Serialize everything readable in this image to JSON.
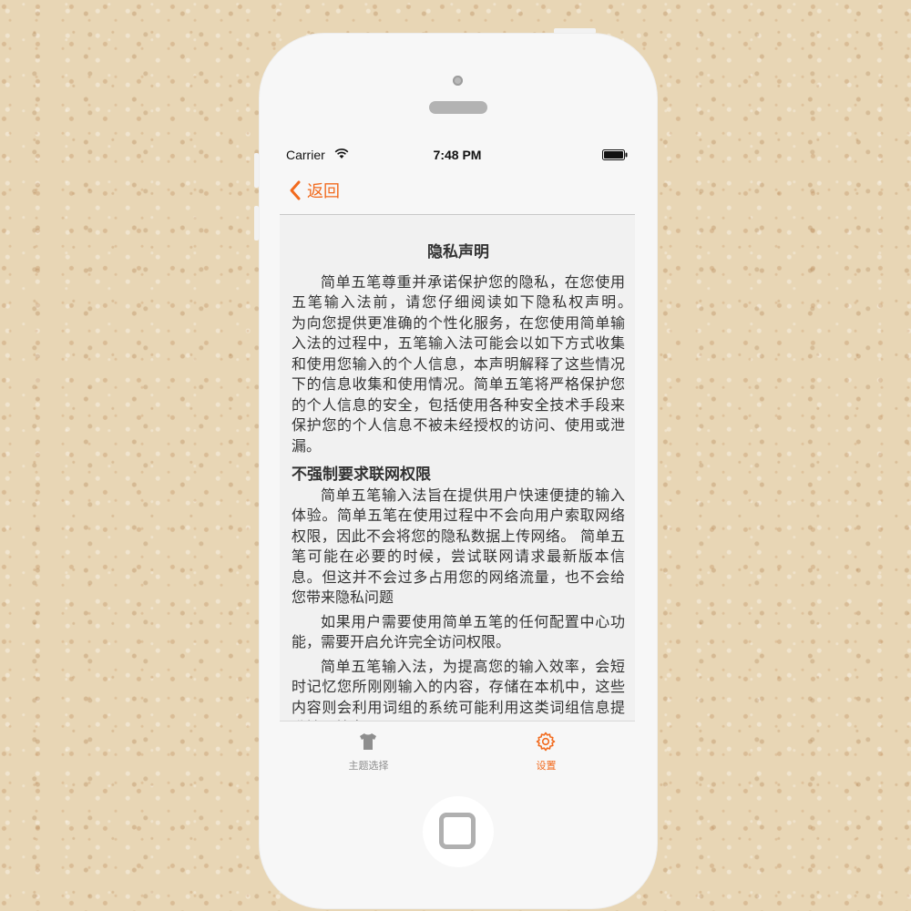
{
  "status_bar": {
    "carrier": "Carrier",
    "time": "7:48 PM",
    "wifi_icon": "wifi-icon",
    "battery_icon": "battery-icon"
  },
  "nav": {
    "back_label": "返回",
    "back_icon": "chevron-left-icon"
  },
  "document": {
    "title": "隐私声明",
    "intro": "简单五笔尊重并承诺保护您的隐私，在您使用五笔输入法前，请您仔细阅读如下隐私权声明。　　为向您提供更准确的个性化服务，在您使用简单输入法的过程中，五笔输入法可能会以如下方式收集和使用您输入的个人信息，本声明解释了这些情况下的信息收集和使用情况。简单五笔将严格保护您的个人信息的安全，包括使用各种安全技术手段来保护您的个人信息不被未经授权的访问、使用或泄漏。",
    "section_heading": "不强制要求联网权限",
    "section_para_1": "简单五笔输入法旨在提供用户快速便捷的输入体验。简单五笔在使用过程中不会向用户索取网络权限，因此不会将您的隐私数据上传网络。 简单五笔可能在必要的时候，尝试联网请求最新版本信息。但这并不会过多占用您的网络流量，也不会给您带来隐私问题",
    "section_para_2": "如果用户需要使用简单五笔的任何配置中心功能，需要开启允许完全访问权限。",
    "section_para_3": "简单五笔输入法，为提高您的输入效率，会短时记忆您所刚刚输入的内容，存储在本机中，这些内容则会利用词组的系统可能利用这类词组信息提升输入效率。"
  },
  "tab_bar": {
    "tabs": [
      {
        "label": "主题选择",
        "icon": "tshirt-icon",
        "active": false
      },
      {
        "label": "设置",
        "icon": "gear-icon",
        "active": true
      }
    ]
  },
  "colors": {
    "accent": "#f26a1d",
    "inactive": "#8e8e8e",
    "text": "#333333"
  }
}
